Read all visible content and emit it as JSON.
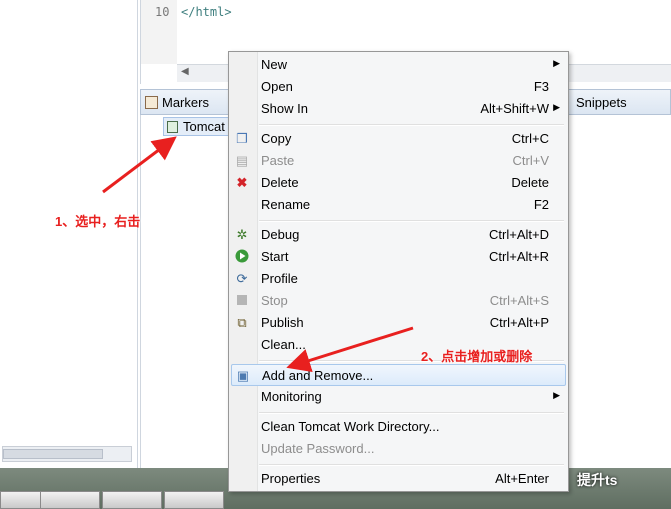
{
  "editor": {
    "line_number": "10",
    "code": "</html>"
  },
  "views": {
    "markers_tab": "Markers",
    "snippets_tab": "Snippets",
    "server_item": "Tomcat"
  },
  "annotations": {
    "step1": "1、选中，右击",
    "step2": "2、点击增加或删除",
    "color": "#e8201f"
  },
  "menu": {
    "new": "New",
    "open": "Open",
    "open_sc": "F3",
    "show_in": "Show In",
    "show_in_sc": "Alt+Shift+W",
    "copy": "Copy",
    "copy_sc": "Ctrl+C",
    "paste": "Paste",
    "paste_sc": "Ctrl+V",
    "delete": "Delete",
    "delete_sc": "Delete",
    "rename": "Rename",
    "rename_sc": "F2",
    "debug": "Debug",
    "debug_sc": "Ctrl+Alt+D",
    "start": "Start",
    "start_sc": "Ctrl+Alt+R",
    "profile": "Profile",
    "stop": "Stop",
    "stop_sc": "Ctrl+Alt+S",
    "publish": "Publish",
    "publish_sc": "Ctrl+Alt+P",
    "clean": "Clean...",
    "add_remove": "Add and Remove...",
    "monitoring": "Monitoring",
    "clean_work_dir": "Clean Tomcat Work Directory...",
    "update_password": "Update Password...",
    "properties": "Properties",
    "properties_sc": "Alt+Enter"
  },
  "icons": {
    "copy": "copy-icon",
    "paste": "paste-icon",
    "delete": "delete-icon",
    "debug": "debug-icon",
    "start": "start-icon",
    "profile": "profile-icon",
    "stop": "stop-icon",
    "publish": "publish-icon",
    "add_remove": "add-remove-icon"
  },
  "watermark": "提升ts"
}
